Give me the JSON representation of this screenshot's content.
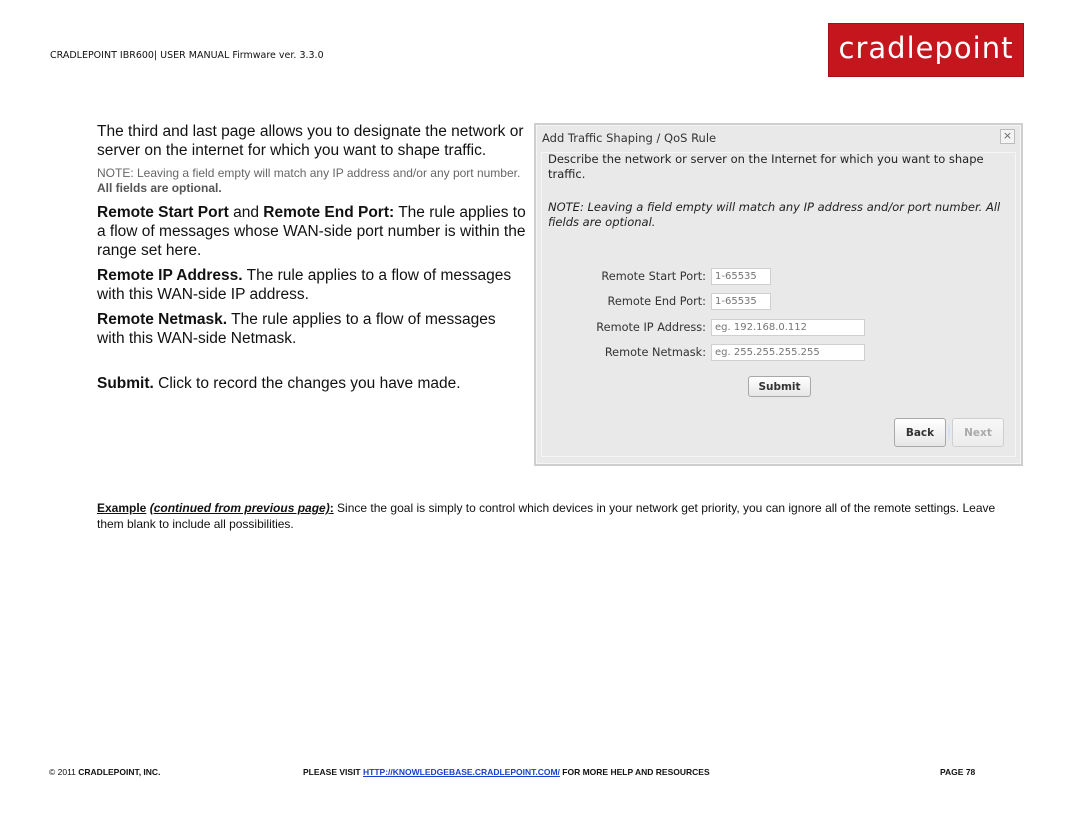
{
  "header": {
    "manual_title": "CRADLEPOINT IBR600| USER MANUAL Firmware ver. 3.3.0",
    "logo_text": "cradlepoint",
    "logo_color": "#c4161c"
  },
  "left_column": {
    "intro": "The third and last page allows you to designate the network or server on the internet for which you want to shape traffic.",
    "note_prefix": "NOTE: Leaving a field empty will match any IP address and/or any port number.",
    "note_bold": "All fields are optional.",
    "ports": {
      "bold1": "Remote Start Port",
      "mid": " and ",
      "bold2": "Remote End Port:",
      "text": " The rule applies to a flow of messages whose WAN-side port number is within the range set here."
    },
    "ip": {
      "bold": "Remote IP Address.",
      "text": " The rule applies to a flow of messages with this WAN-side IP address."
    },
    "netmask": {
      "bold": "Remote Netmask.",
      "text": " The rule applies to a flow of messages with this WAN-side Netmask."
    },
    "submit": {
      "bold": "Submit.",
      "text": " Click to record the changes you have made."
    }
  },
  "dialog": {
    "title": "Add Traffic Shaping / QoS Rule",
    "close_label": "×",
    "description": "Describe the network or server on the Internet for which you want to shape traffic.",
    "note": "NOTE: Leaving a field empty will match any IP address and/or port number. All fields are optional.",
    "fields": [
      {
        "label": "Remote Start Port:",
        "placeholder": "1-65535",
        "value": ""
      },
      {
        "label": "Remote End Port:",
        "placeholder": "1-65535",
        "value": ""
      },
      {
        "label": "Remote IP Address:",
        "placeholder": "eg. 192.168.0.112",
        "value": ""
      },
      {
        "label": "Remote Netmask:",
        "placeholder": "eg. 255.255.255.255",
        "value": ""
      }
    ],
    "submit_label": "Submit",
    "back_label": "Back",
    "next_label": "Next"
  },
  "example": {
    "label": "Example",
    "italic": "(continued from previous page)",
    "colon": ":",
    "text": " Since the goal is simply to control which devices in your network get priority, you can ignore all of the remote settings. Leave them blank to include all possibilities."
  },
  "footer": {
    "copyright_prefix": "© 2011 ",
    "company": "CRADLEPOINT, INC.",
    "visit_prefix": "PLEASE VISIT ",
    "link": "HTTP://KNOWLEDGEBASE.CRADLEPOINT.COM/",
    "visit_suffix": " FOR MORE HELP AND RESOURCES",
    "page": "PAGE 78",
    "link_color": "#1a3fcc"
  }
}
